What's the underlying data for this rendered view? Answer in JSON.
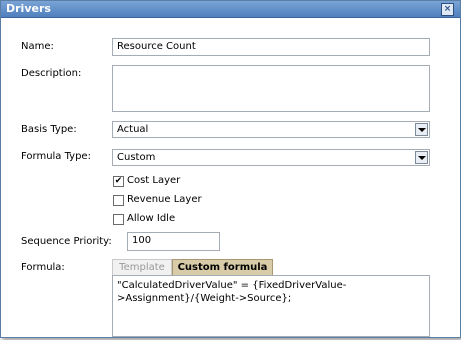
{
  "dialog": {
    "title": "Drivers",
    "close_symbol": "×"
  },
  "fields": {
    "name_label": "Name:",
    "name_value": "Resource Count",
    "description_label": "Description:",
    "description_value": "",
    "basis_type_label": "Basis Type:",
    "basis_type_value": "Actual",
    "formula_type_label": "Formula Type:",
    "formula_type_value": "Custom",
    "cost_layer_label": "Cost Layer",
    "cost_layer_checked": true,
    "cost_layer_mark": "✔",
    "revenue_layer_label": "Revenue Layer",
    "revenue_layer_checked": false,
    "allow_idle_label": "Allow Idle",
    "allow_idle_checked": false,
    "sequence_priority_label": "Sequence Priority:",
    "sequence_priority_value": "100",
    "formula_label": "Formula:"
  },
  "formula_tabs": [
    {
      "label": "Template",
      "active": false
    },
    {
      "label": "Custom formula",
      "active": true
    }
  ],
  "formula_text": "\"CalculatedDriverValue\" = {FixedDriverValue->Assignment}/{Weight->Source};",
  "icons": {
    "close": "close-icon",
    "dropdown": "chevron-down-icon",
    "checkmark": "checkmark-icon"
  }
}
